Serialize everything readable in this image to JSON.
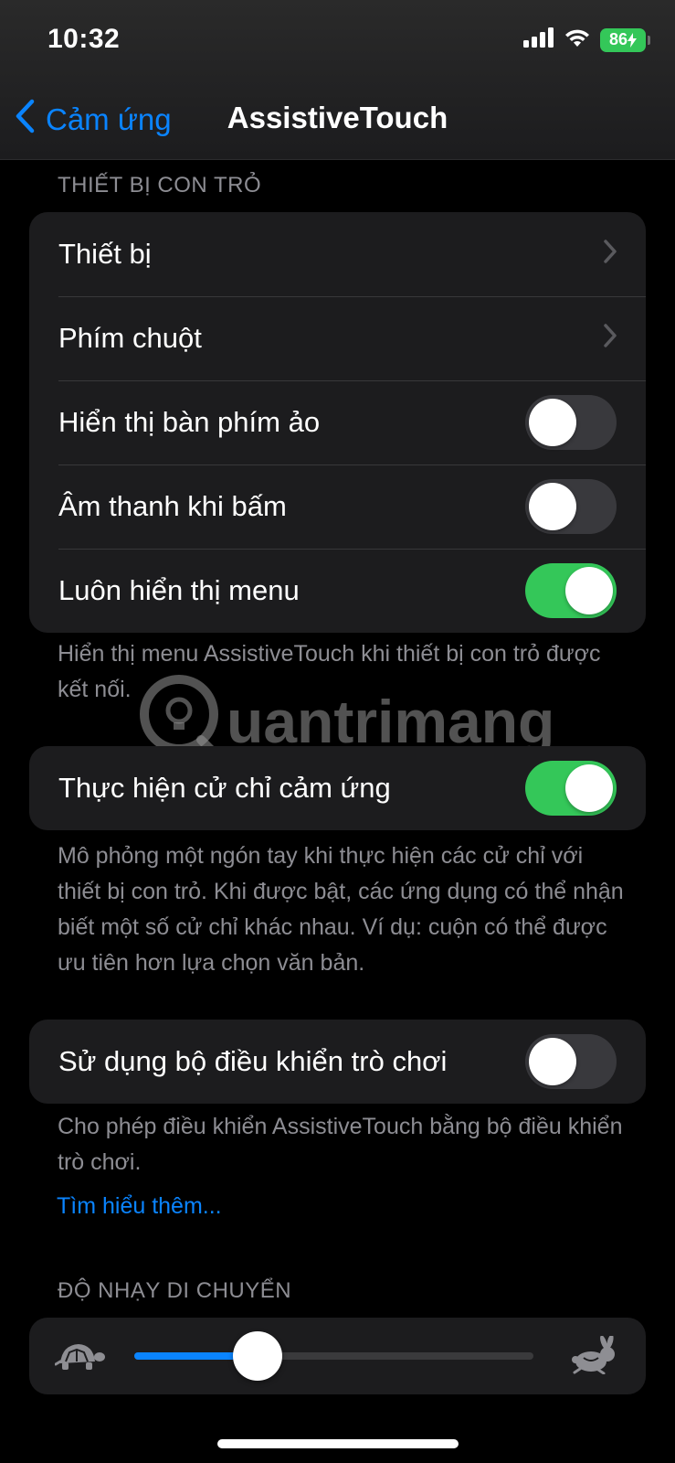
{
  "status_bar": {
    "time": "10:32",
    "battery": "86"
  },
  "nav": {
    "back_label": "Cảm ứng",
    "title": "AssistiveTouch"
  },
  "pointer_section": {
    "header": "THIẾT BỊ CON TRỎ",
    "rows": [
      {
        "label": "Thiết bị",
        "type": "link"
      },
      {
        "label": "Phím chuột",
        "type": "link"
      },
      {
        "label": "Hiển thị bàn phím ảo",
        "type": "toggle",
        "on": false
      },
      {
        "label": "Âm thanh khi bấm",
        "type": "toggle",
        "on": false
      },
      {
        "label": "Luôn hiển thị menu",
        "type": "toggle",
        "on": true
      }
    ],
    "footer": "Hiển thị menu AssistiveTouch khi thiết bị con trỏ được kết nối."
  },
  "gesture_section": {
    "label": "Thực hiện cử chỉ cảm ứng",
    "on": true,
    "footer": "Mô phỏng một ngón tay khi thực hiện các cử chỉ với thiết bị con trỏ. Khi được bật, các ứng dụng có thể nhận biết một số cử chỉ khác nhau. Ví dụ: cuộn có thể được ưu tiên hơn lựa chọn văn bản."
  },
  "game_controller_section": {
    "label": "Sử dụng bộ điều khiển trò chơi",
    "on": false,
    "footer": "Cho phép điều khiển AssistiveTouch bằng bộ điều khiển trò chơi.",
    "link": "Tìm hiểu thêm..."
  },
  "sensitivity_section": {
    "header": "ĐỘ NHẠY DI CHUYỂN",
    "value_fraction": 0.31,
    "min_icon": "turtle-icon",
    "max_icon": "rabbit-icon"
  },
  "watermark": {
    "text": "uantrimang"
  },
  "colors": {
    "accent": "#0a84ff",
    "toggle_on": "#34c759",
    "toggle_off": "#39393d",
    "cell_bg": "#1c1c1e",
    "secondary_text": "#8d8d93"
  }
}
